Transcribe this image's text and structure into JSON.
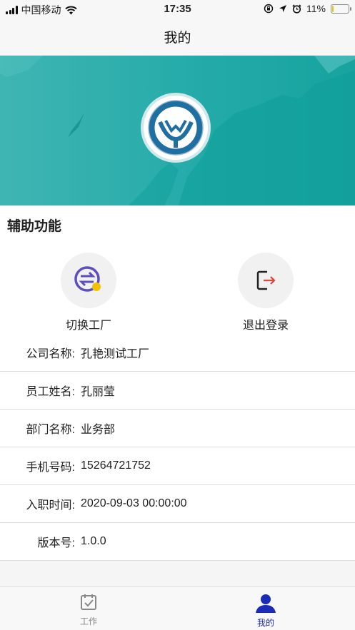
{
  "status_bar": {
    "carrier": "中国移动",
    "time": "17:35",
    "battery_text": "11%",
    "battery_level": 0.11
  },
  "nav": {
    "title": "我的"
  },
  "aux": {
    "title": "辅助功能",
    "functions": [
      {
        "label": "切换工厂",
        "icon": "switch-arrows-icon"
      },
      {
        "label": "退出登录",
        "icon": "logout-icon"
      }
    ]
  },
  "info": {
    "rows": [
      {
        "key": "公司名称:",
        "value": "孔艳测试工厂"
      },
      {
        "key": "员工姓名:",
        "value": "孔丽莹"
      },
      {
        "key": "部门名称:",
        "value": "业务部"
      },
      {
        "key": "手机号码:",
        "value": "15264721752"
      },
      {
        "key": "入职时间:",
        "value": "2020-09-03 00:00:00"
      },
      {
        "key": "版本号:",
        "value": "1.0.0"
      }
    ]
  },
  "tabs": [
    {
      "label": "工作",
      "icon": "checklist-icon",
      "active": false,
      "color": "#888888"
    },
    {
      "label": "我的",
      "icon": "user-icon",
      "active": true,
      "color": "#1a2bb8"
    }
  ],
  "colors": {
    "banner": "#22aaa8",
    "accent": "#1a2bb8",
    "logo_blue": "#1f6fa3"
  }
}
